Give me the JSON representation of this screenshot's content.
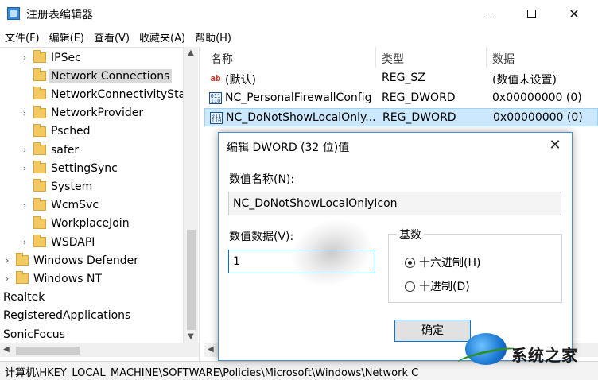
{
  "window": {
    "title": "注册表编辑器",
    "minimize_symbol": "",
    "close_symbol": "✕"
  },
  "menu": [
    "文件(F)",
    "编辑(E)",
    "查看(V)",
    "收藏夹(A)",
    "帮助(H)"
  ],
  "tree": {
    "items": [
      {
        "label": "IPSec",
        "indent": 1,
        "expander": "›",
        "folder": true,
        "selected": false
      },
      {
        "label": "Network Connections",
        "indent": 1,
        "expander": "",
        "folder": true,
        "selected": true
      },
      {
        "label": "NetworkConnectivityStat",
        "indent": 1,
        "expander": "",
        "folder": true,
        "selected": false
      },
      {
        "label": "NetworkProvider",
        "indent": 1,
        "expander": "›",
        "folder": true,
        "selected": false
      },
      {
        "label": "Psched",
        "indent": 1,
        "expander": "",
        "folder": true,
        "selected": false
      },
      {
        "label": "safer",
        "indent": 1,
        "expander": "›",
        "folder": true,
        "selected": false
      },
      {
        "label": "SettingSync",
        "indent": 1,
        "expander": "›",
        "folder": true,
        "selected": false
      },
      {
        "label": "System",
        "indent": 1,
        "expander": "",
        "folder": true,
        "selected": false
      },
      {
        "label": "WcmSvc",
        "indent": 1,
        "expander": "›",
        "folder": true,
        "selected": false
      },
      {
        "label": "WorkplaceJoin",
        "indent": 1,
        "expander": "",
        "folder": true,
        "selected": false
      },
      {
        "label": "WSDAPI",
        "indent": 1,
        "expander": "›",
        "folder": true,
        "selected": false
      },
      {
        "label": "Windows Defender",
        "indent": 0,
        "expander": "›",
        "folder": true,
        "selected": false
      },
      {
        "label": "Windows NT",
        "indent": 0,
        "expander": "›",
        "folder": true,
        "selected": false
      },
      {
        "label": "Realtek",
        "indent": -1,
        "expander": "",
        "folder": false,
        "selected": false
      },
      {
        "label": "RegisteredApplications",
        "indent": -1,
        "expander": "",
        "folder": false,
        "selected": false
      },
      {
        "label": "SonicFocus",
        "indent": -1,
        "expander": "",
        "folder": false,
        "selected": false
      }
    ]
  },
  "list": {
    "headers": {
      "name": "名称",
      "type": "类型",
      "data": "数据"
    },
    "rows": [
      {
        "icon": "string-value-icon",
        "name": "(默认)",
        "type": "REG_SZ",
        "data": "(数值未设置)",
        "selected": false
      },
      {
        "icon": "dword-value-icon",
        "name": "NC_PersonalFirewallConfig",
        "type": "REG_DWORD",
        "data": "0x00000000 (0)",
        "selected": false
      },
      {
        "icon": "dword-value-icon",
        "name": "NC_DoNotShowLocalOnly...",
        "type": "REG_DWORD",
        "data": "0x00000000 (0)",
        "selected": true
      }
    ]
  },
  "statusbar": {
    "path": "计算机\\HKEY_LOCAL_MACHINE\\SOFTWARE\\Policies\\Microsoft\\Windows\\Network C"
  },
  "dialog": {
    "title": "编辑 DWORD (32 位)值",
    "value_name_label": "数值名称(N):",
    "value_name": "NC_DoNotShowLocalOnlyIcon",
    "value_data_label": "数值数据(V):",
    "value_data": "1",
    "base_label": "基数",
    "base_options": [
      {
        "label": "十六进制(H)",
        "checked": true
      },
      {
        "label": "十进制(D)",
        "checked": false
      }
    ],
    "ok_label": "确定"
  },
  "watermark": {
    "text": "系统之家"
  }
}
